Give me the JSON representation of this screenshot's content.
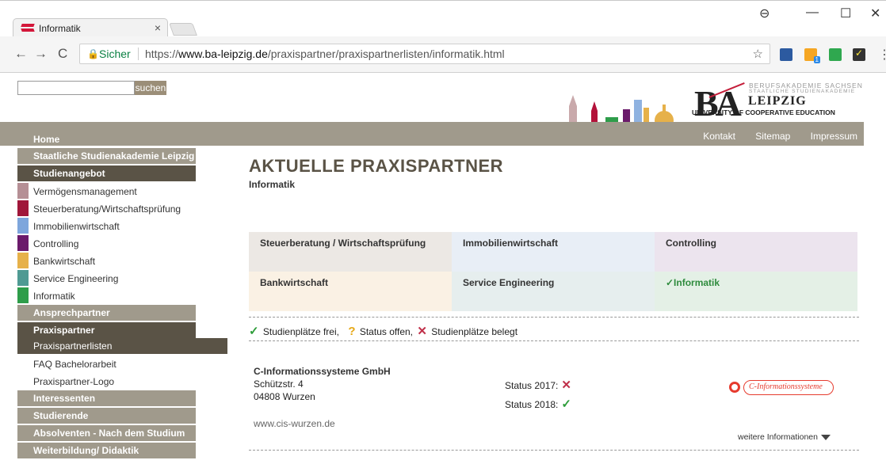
{
  "browser": {
    "tab_title": "Informatik",
    "tab_close": "×",
    "window": {
      "profile": "⊖",
      "minimize": "—",
      "maximize": "☐",
      "close": "✕"
    },
    "nav": {
      "back": "←",
      "forward": "→",
      "reload": "C"
    },
    "secure_label": "Sicher",
    "url_scheme": "https://",
    "url_host": "www.ba-leipzig.de",
    "url_path": "/praxispartner/praxispartnerlisten/informatik.html",
    "star": "☆",
    "ext_badge": "1",
    "menu": "⋮"
  },
  "header": {
    "search_placeholder": "",
    "search_button": "suchen",
    "logo_ba": "BA",
    "logo_line1": "BERUFSAKADEMIE SACHSEN",
    "logo_line2": "STAATLICHE STUDIENAKADEMIE",
    "logo_line3": "LEIPZIG",
    "logo_line4": "UNIVERSITY OF COOPERATIVE EDUCATION"
  },
  "topnav": {
    "home": "Home",
    "links": [
      "Kontakt",
      "Sitemap",
      "Impressum"
    ]
  },
  "sidebar": {
    "head1": "Staatliche Studienakademie Leipzig",
    "head2": "Studienangebot",
    "programs": [
      {
        "label": "Vermögensmanagement",
        "color": "#b58f95"
      },
      {
        "label": "Steuerberatung/Wirtschaftsprüfung",
        "color": "#a0173a"
      },
      {
        "label": "Immobilienwirtschaft",
        "color": "#7ea6dc"
      },
      {
        "label": "Controlling",
        "color": "#6b1a6b"
      },
      {
        "label": "Bankwirtschaft",
        "color": "#e6b14a"
      },
      {
        "label": "Service Engineering",
        "color": "#4f9a93"
      },
      {
        "label": "Informatik",
        "color": "#2e9d4a"
      }
    ],
    "head3": "Ansprechpartner",
    "head4": "Praxispartner",
    "sub_active": "Praxispartnerlisten",
    "plain1": "FAQ Bachelorarbeit",
    "plain2": "Praxispartner-Logo",
    "head5": "Interessenten",
    "head6": "Studierende",
    "head7": "Absolventen - Nach dem Studium",
    "head8": "Weiterbildung/ Didaktik"
  },
  "main": {
    "title": "AKTUELLE PRAXISPARTNER",
    "subtitle": "Informatik",
    "categories": [
      {
        "label": "Steuerberatung / Wirtschaftsprüfung",
        "bg": "#ece8e4"
      },
      {
        "label": "Immobilienwirtschaft",
        "bg": "#e8eef6"
      },
      {
        "label": "Controlling",
        "bg": "#ece4ee"
      },
      {
        "label": "Bankwirtschaft",
        "bg": "#faf1e4"
      },
      {
        "label": "Service Engineering",
        "bg": "#e6eeee"
      },
      {
        "label": "✓Informatik",
        "bg": "#e4f0e6"
      }
    ],
    "legend": {
      "ok_icon": "✓",
      "ok_label": "Studienplätze frei,",
      "open_icon": "?",
      "open_label": "Status offen,",
      "no_icon": "✕",
      "no_label": "Studienplätze belegt"
    },
    "partner": {
      "name": "C-Informationssysteme GmbH",
      "street": "Schützstr. 4",
      "city": "04808 Wurzen",
      "website": "www.cis-wurzen.de",
      "status1_label": "Status 2017:",
      "status1_icon": "✕",
      "status2_label": "Status 2018:",
      "status2_icon": "✓",
      "logo_text": "C-Informationssysteme",
      "more": "weitere Informationen"
    }
  }
}
